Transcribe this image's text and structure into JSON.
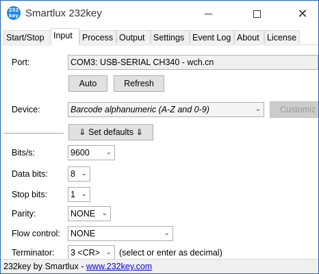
{
  "app": {
    "title": "Smartlux 232key",
    "icon_text": "232\nkey",
    "icon": "app-logo-icon",
    "accent_color": "#1e88e5"
  },
  "window_controls": {
    "minimize": "minimize-icon",
    "maximize": "maximize-icon",
    "close": "close-icon",
    "close_glyph": "✕"
  },
  "tabs": [
    {
      "label": "Start/Stop",
      "active": false
    },
    {
      "label": "Input",
      "active": true
    },
    {
      "label": "Process",
      "active": false
    },
    {
      "label": "Output",
      "active": false
    },
    {
      "label": "Settings",
      "active": false
    },
    {
      "label": "Event Log",
      "active": false
    },
    {
      "label": "About",
      "active": false
    },
    {
      "label": "License",
      "active": false
    }
  ],
  "input": {
    "port_label": "Port:",
    "port_value": "COM3: USB-SERIAL CH340 - wch.cn",
    "auto_button": "Auto",
    "refresh_button": "Refresh",
    "device_label": "Device:",
    "device_value": "Barcode alphanumeric (A-Z and 0-9)",
    "customize_button": "Customiz",
    "set_defaults_button": "⇓ Set defaults ⇓",
    "bits_label": "Bits/s:",
    "bits_value": "9600",
    "databits_label": "Data bits:",
    "databits_value": "8",
    "stopbits_label": "Stop bits:",
    "stopbits_value": "1",
    "parity_label": "Parity:",
    "parity_value": "NONE",
    "flow_label": "Flow control:",
    "flow_value": "NONE",
    "terminator_label": "Terminator:",
    "terminator_value": "3 <CR>",
    "terminator_hint": "(select or enter as decimal)"
  },
  "status": {
    "text": "232key by Smartlux - ",
    "link": "www.232key.com"
  }
}
